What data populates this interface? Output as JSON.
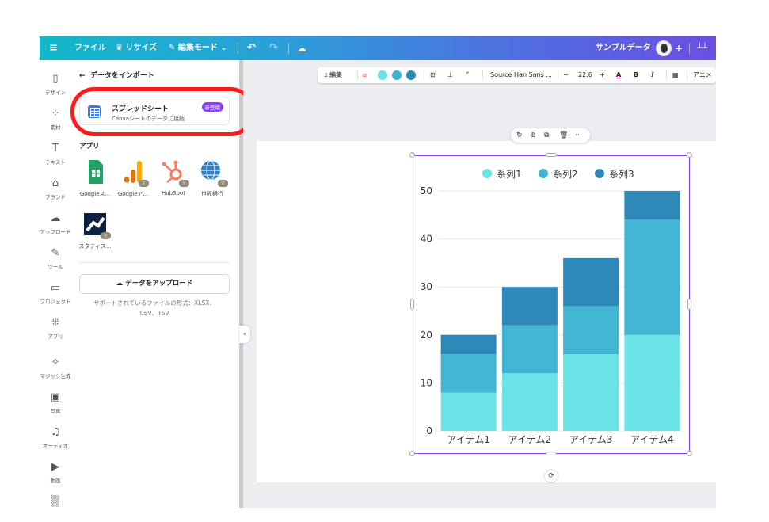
{
  "topbar": {
    "file": "ファイル",
    "resize": "リサイズ",
    "edit_mode": "編集モード",
    "doc_title": "サンプルデータ",
    "plus": "+"
  },
  "rail": {
    "items": [
      {
        "label": "デザイン",
        "icon": "layout-icon"
      },
      {
        "label": "素材",
        "icon": "elements-icon"
      },
      {
        "label": "テキスト",
        "icon": "text-icon"
      },
      {
        "label": "ブランド",
        "icon": "brand-icon"
      },
      {
        "label": "アップロード",
        "icon": "upload-icon"
      },
      {
        "label": "ツール",
        "icon": "draw-icon"
      },
      {
        "label": "プロジェクト",
        "icon": "folder-icon"
      },
      {
        "label": "アプリ",
        "icon": "apps-icon"
      },
      {
        "label": "マジック生成",
        "icon": "magic-icon"
      },
      {
        "label": "写真",
        "icon": "photo-icon"
      },
      {
        "label": "オーディオ",
        "icon": "audio-icon"
      },
      {
        "label": "動画",
        "icon": "video-icon"
      }
    ]
  },
  "panel": {
    "back_title": "データをインポート",
    "spreadsheet_title": "スプレッドシート",
    "spreadsheet_desc": "Canvaシートのデータに接続",
    "new_badge": "新登場",
    "apps_heading": "アプリ",
    "apps": [
      {
        "label": "Googleス...",
        "color": "#1fa463"
      },
      {
        "label": "Googleア...",
        "color": "#f9ab00"
      },
      {
        "label": "HubSpot",
        "color": "#ff7a59"
      },
      {
        "label": "世界銀行",
        "color": "#2c7fc9"
      },
      {
        "label": "スタティス...",
        "color": "#0d2140"
      }
    ],
    "upload_label": "データをアップロード",
    "support_line1": "サポートされているファイルの形式：XLSX、",
    "support_line2": "CSV、TSV"
  },
  "toolbar": {
    "edit": "編集",
    "font": "Source Han Sans ...",
    "minus": "−",
    "size": "22.6",
    "plus": "+",
    "font_color": "A",
    "bold": "B",
    "italic": "I",
    "animate": "アニメ",
    "swatches": [
      "#6de0e8",
      "#3fb2d0",
      "#2b88b8"
    ]
  },
  "chart_data": {
    "type": "bar",
    "stacked": true,
    "categories": [
      "アイテム1",
      "アイテム2",
      "アイテム3",
      "アイテム4"
    ],
    "series": [
      {
        "name": "系列1",
        "values": [
          8,
          12,
          16,
          20
        ],
        "color": "#6ae3e6"
      },
      {
        "name": "系列2",
        "values": [
          8,
          10,
          10,
          24
        ],
        "color": "#41b5d1"
      },
      {
        "name": "系列3",
        "values": [
          4,
          8,
          10,
          6
        ],
        "color": "#2d88b8"
      }
    ],
    "ylim": [
      0,
      50
    ],
    "yticks": [
      "0",
      "10",
      "20",
      "30",
      "40",
      "50"
    ],
    "legend": "top",
    "grid": true
  }
}
